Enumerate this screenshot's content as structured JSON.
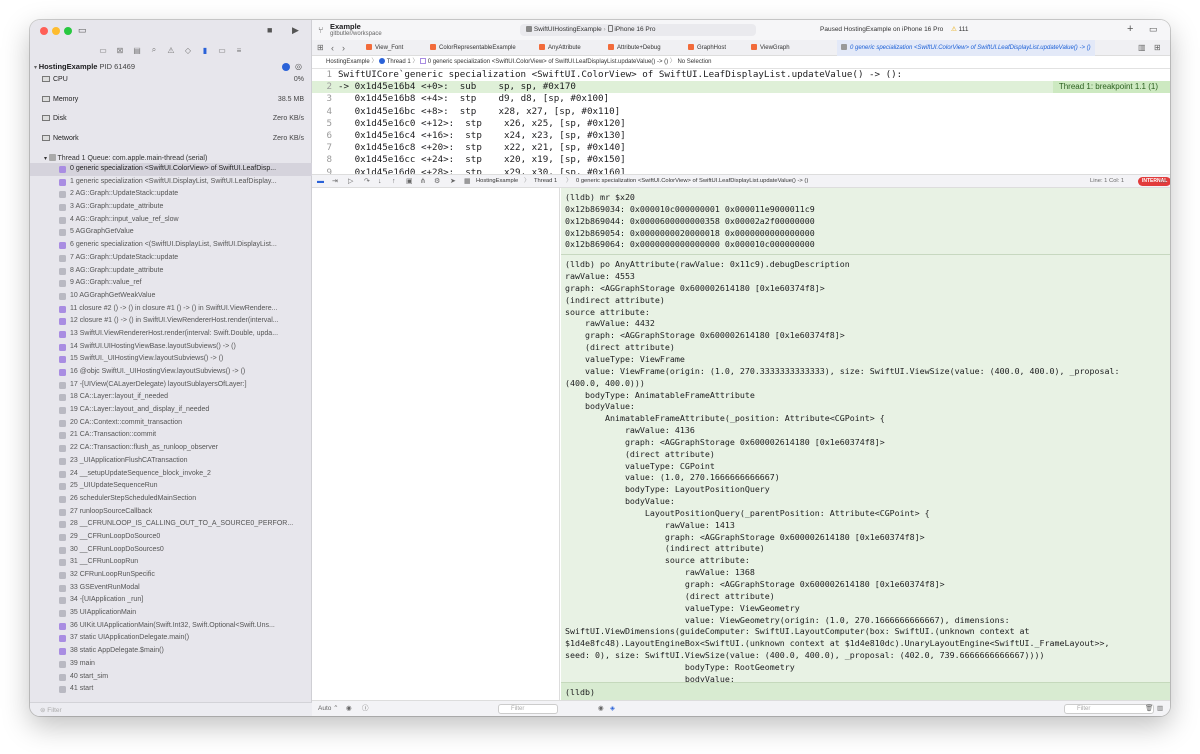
{
  "sidebar": {
    "process": {
      "name": "HostingExample",
      "pid": "PID 61469"
    },
    "gauges": [
      {
        "label": "CPU",
        "value": "0%"
      },
      {
        "label": "Memory",
        "value": "38.5 MB"
      },
      {
        "label": "Disk",
        "value": "Zero KB/s"
      },
      {
        "label": "Network",
        "value": "Zero KB/s"
      }
    ],
    "thread": "Thread 1 Queue: com.apple.main-thread (serial)",
    "frames": [
      "0 generic specialization <SwiftUI.ColorView> of SwiftUI.LeafDisp...",
      "1 generic specialization <SwiftUI.DisplayList, SwiftUI.LeafDisplay...",
      "2 AG::Graph::UpdateStack::update",
      "3 AG::Graph::update_attribute",
      "4 AG::Graph::input_value_ref_slow",
      "5 AGGraphGetValue",
      "6 generic specialization <(SwiftUI.DisplayList, SwiftUI.DisplayList...",
      "7 AG::Graph::UpdateStack::update",
      "8 AG::Graph::update_attribute",
      "9 AG::Graph::value_ref",
      "10 AGGraphGetWeakValue",
      "11 closure #2 () -> () in closure #1 () -> () in SwiftUI.ViewRendere...",
      "12 closure #1 () -> () in SwiftUI.ViewRendererHost.render(interval...",
      "13 SwiftUI.ViewRendererHost.render(interval: Swift.Double, upda...",
      "14 SwiftUI.UIHostingViewBase.layoutSubviews() -> ()",
      "15 SwiftUI._UIHostingView.layoutSubviews() -> ()",
      "16 @objc SwiftUI._UIHostingView.layoutSubviews() -> ()",
      "17 -[UIView(CALayerDelegate) layoutSublayersOfLayer:]",
      "18 CA::Layer::layout_if_needed",
      "19 CA::Layer::layout_and_display_if_needed",
      "20 CA::Context::commit_transaction",
      "21 CA::Transaction::commit",
      "22 CA::Transaction::flush_as_runloop_observer",
      "23 _UIApplicationFlushCATransaction",
      "24 __setupUpdateSequence_block_invoke_2",
      "25 _UIUpdateSequenceRun",
      "26 schedulerStepScheduledMainSection",
      "27 runloopSourceCallback",
      "28 __CFRUNLOOP_IS_CALLING_OUT_TO_A_SOURCE0_PERFOR...",
      "29 __CFRunLoopDoSource0",
      "30 __CFRunLoopDoSources0",
      "31 __CFRunLoopRun",
      "32 CFRunLoopRunSpecific",
      "33 GSEventRunModal",
      "34 -[UIApplication _run]",
      "35 UIApplicationMain",
      "36 UIKit.UIApplicationMain(Swift.Int32, Swift.Optional<Swift.Uns...",
      "37 static UIApplicationDelegate.main()",
      "38 static AppDelegate.$main()",
      "39 main",
      "40 start_sim",
      "41 start"
    ],
    "filter_placeholder": "Filter"
  },
  "toolbar": {
    "project": "Example",
    "branch": "gitbutler/workspace",
    "scheme": "SwiftUIHostingExample",
    "device": "iPhone 16 Pro",
    "status": "Paused HostingExample on iPhone 16 Pro",
    "warnings": "111"
  },
  "tabs": [
    "View_Font",
    "ColorRepresentableExample",
    "AnyAttribute",
    "Attribute+Debug",
    "GraphHost",
    "ViewGraph",
    "0 generic specialization <SwiftUI.ColorView> of SwiftUI.LeafDisplayList.updateValue() -> ()"
  ],
  "jumpbar": {
    "items": [
      "HostingExample",
      "Thread 1",
      "0 generic specialization <SwiftUI.ColorView> of SwiftUI.LeafDisplayList.updateValue() -> ()",
      "No Selection"
    ]
  },
  "code": {
    "breakpoint": "Thread 1: breakpoint 1.1 (1)",
    "lines": [
      {
        "n": "1",
        "addr": "",
        "text": "SwiftUICore`generic specialization <SwiftUI.ColorView> of SwiftUI.LeafDisplayList.updateValue() -> ():"
      },
      {
        "n": "2",
        "addr": "0x1d45e16b4 <+0>:",
        "text": "sub    sp, sp, #0x170"
      },
      {
        "n": "3",
        "addr": "0x1d45e16b8 <+4>:",
        "text": "stp    d9, d8, [sp, #0x100]"
      },
      {
        "n": "4",
        "addr": "0x1d45e16bc <+8>:",
        "text": "stp    x28, x27, [sp, #0x110]"
      },
      {
        "n": "5",
        "addr": "0x1d45e16c0 <+12>:",
        "text": "stp    x26, x25, [sp, #0x120]"
      },
      {
        "n": "6",
        "addr": "0x1d45e16c4 <+16>:",
        "text": "stp    x24, x23, [sp, #0x130]"
      },
      {
        "n": "7",
        "addr": "0x1d45e16c8 <+20>:",
        "text": "stp    x22, x21, [sp, #0x140]"
      },
      {
        "n": "8",
        "addr": "0x1d45e16cc <+24>:",
        "text": "stp    x20, x19, [sp, #0x150]"
      },
      {
        "n": "9",
        "addr": "0x1d45e16d0 <+28>:",
        "text": "stp    x29, x30, [sp, #0x160]"
      }
    ]
  },
  "debugbar": {
    "line": "Line: 1  Col: 1",
    "badge": "INTERNAL"
  },
  "console": {
    "block1": [
      "(lldb) mr $x20",
      "0x12b869034: 0x000010c000000001 0x000011e9000011c9",
      "0x12b869044: 0x0000600000000358 0x00002a2f00000000",
      "0x12b869054: 0x0000000020000018 0x0000000000000000",
      "0x12b869064: 0x0000000000000000 0x000010c000000000"
    ],
    "block2": [
      "(lldb) po AnyAttribute(rawValue: 0x11c9).debugDescription",
      "rawValue: 4553",
      "graph: <AGGraphStorage 0x600002614180 [0x1e60374f8]>",
      "(indirect attribute)",
      "source attribute:",
      "    rawValue: 4432",
      "    graph: <AGGraphStorage 0x600002614180 [0x1e60374f8]>",
      "    (direct attribute)",
      "    valueType: ViewFrame",
      "    value: ViewFrame(origin: (1.0, 270.3333333333333), size: SwiftUI.ViewSize(value: (400.0, 400.0), _proposal:",
      "(400.0, 400.0)))",
      "    bodyType: AnimatableFrameAttribute",
      "    bodyValue:",
      "        AnimatableFrameAttribute(_position: Attribute<CGPoint> {",
      "            rawValue: 4136",
      "            graph: <AGGraphStorage 0x600002614180 [0x1e60374f8]>",
      "            (direct attribute)",
      "            valueType: CGPoint",
      "            value: (1.0, 270.1666666666667)",
      "            bodyType: LayoutPositionQuery",
      "            bodyValue:",
      "                LayoutPositionQuery(_parentPosition: Attribute<CGPoint> {",
      "                    rawValue: 1413",
      "                    graph: <AGGraphStorage 0x600002614180 [0x1e60374f8]>",
      "                    (indirect attribute)",
      "                    source attribute:",
      "                        rawValue: 1368",
      "                        graph: <AGGraphStorage 0x600002614180 [0x1e60374f8]>",
      "                        (direct attribute)",
      "                        valueType: ViewGeometry",
      "                        value: ViewGeometry(origin: (1.0, 270.1666666666667), dimensions:",
      "SwiftUI.ViewDimensions(guideComputer: SwiftUI.LayoutComputer(box: SwiftUI.(unknown context at",
      "$1d4e8fc48).LayoutEngineBox<SwiftUI.(unknown context at $1d4e810dc).UnaryLayoutEngine<SwiftUI._FrameLayout>>,",
      "seed: 0), size: SwiftUI.ViewSize(value: (400.0, 400.0), _proposal: (402.0, 739.6666666666667))))",
      "                        bodyType: RootGeometry",
      "                        bodyValue:"
    ],
    "prompt": "(lldb)"
  },
  "bottom": {
    "auto": "Auto",
    "filter": "Filter"
  }
}
